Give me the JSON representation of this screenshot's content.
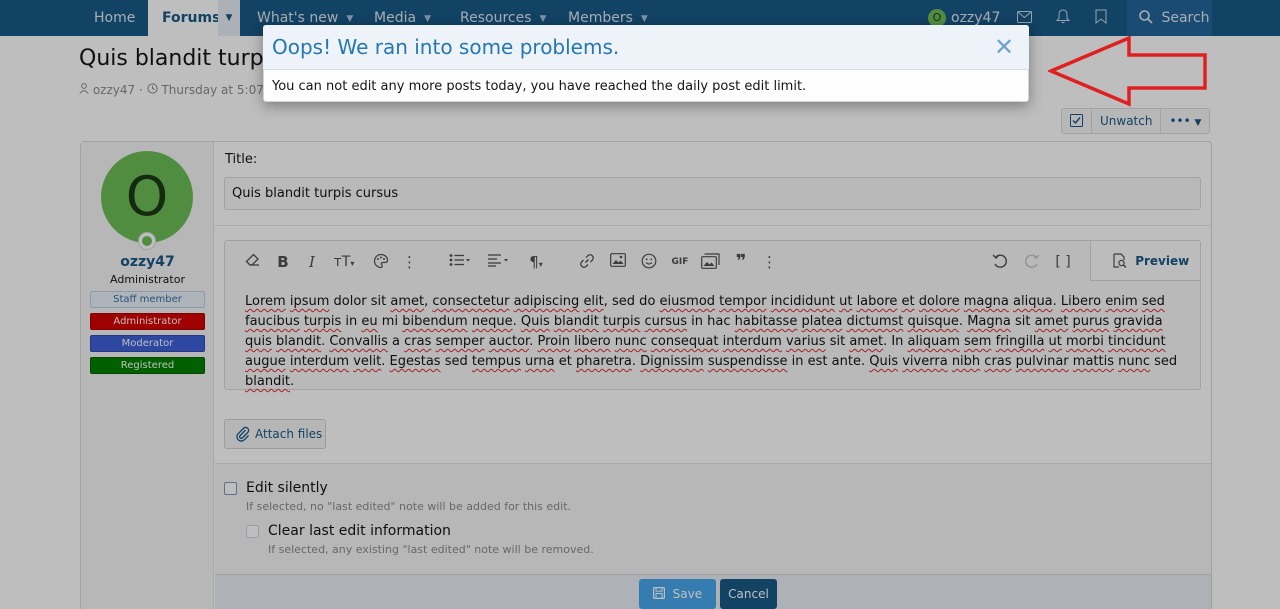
{
  "nav": {
    "tabs": [
      {
        "label": "Home"
      },
      {
        "label": "Forums"
      },
      {
        "label": "What's new"
      },
      {
        "label": "Media"
      },
      {
        "label": "Resources"
      },
      {
        "label": "Members"
      }
    ],
    "user_initial": "O",
    "username": "ozzy47",
    "search_label": "Search"
  },
  "thread": {
    "title": "Quis blandit turpis",
    "author": "ozzy47",
    "date": "Thursday at 5:07 P",
    "watch_label": "Unwatch"
  },
  "user": {
    "initial": "O",
    "name": "ozzy47",
    "title": "Administrator",
    "banners": [
      "Staff member",
      "Administrator",
      "Moderator",
      "Registered"
    ]
  },
  "form": {
    "title_label": "Title:",
    "title_value": "Quis blandit turpis cursus",
    "preview_label": "Preview",
    "attach_label": "Attach files",
    "edit_silently_label": "Edit silently",
    "edit_silently_hint": "If selected, no \"last edited\" note will be added for this edit.",
    "clear_edit_label": "Clear last edit information",
    "clear_edit_hint": "If selected, any existing \"last edited\" note will be removed.",
    "save_label": "Save",
    "cancel_label": "Cancel"
  },
  "editor": {
    "segments": [
      {
        "t": "Lorem",
        "m": true
      },
      {
        "t": " "
      },
      {
        "t": "ipsum",
        "m": true
      },
      {
        "t": " dolor sit "
      },
      {
        "t": "amet",
        "m": true
      },
      {
        "t": ", "
      },
      {
        "t": "consectetur",
        "m": true
      },
      {
        "t": " "
      },
      {
        "t": "adipiscing",
        "m": true
      },
      {
        "t": " "
      },
      {
        "t": "elit",
        "m": true
      },
      {
        "t": ", sed do "
      },
      {
        "t": "eiusmod",
        "m": true
      },
      {
        "t": " "
      },
      {
        "t": "tempor",
        "m": true
      },
      {
        "t": " "
      },
      {
        "t": "incididunt",
        "m": true
      },
      {
        "t": " "
      },
      {
        "t": "ut",
        "m": true
      },
      {
        "t": " "
      },
      {
        "t": "labore",
        "m": true
      },
      {
        "t": " "
      },
      {
        "t": "et",
        "m": true
      },
      {
        "t": " "
      },
      {
        "t": "dolore",
        "m": true
      },
      {
        "t": " "
      },
      {
        "t": "magna",
        "m": true
      },
      {
        "t": " "
      },
      {
        "t": "aliqua",
        "m": true
      },
      {
        "t": ". "
      },
      {
        "t": "Libero",
        "m": true
      },
      {
        "t": " "
      },
      {
        "t": "enim",
        "m": true
      },
      {
        "t": " "
      },
      {
        "t": "sed",
        "m": true
      },
      {
        "t": " "
      },
      {
        "t": "faucibus",
        "m": true
      },
      {
        "t": " "
      },
      {
        "t": "turpis",
        "m": true
      },
      {
        "t": " in "
      },
      {
        "t": "eu",
        "m": true
      },
      {
        "t": " mi "
      },
      {
        "t": "bibendum",
        "m": true
      },
      {
        "t": " "
      },
      {
        "t": "neque",
        "m": true
      },
      {
        "t": ". "
      },
      {
        "t": "Quis",
        "m": true
      },
      {
        "t": " "
      },
      {
        "t": "blandit",
        "m": true
      },
      {
        "t": " "
      },
      {
        "t": "turpis",
        "m": true
      },
      {
        "t": " "
      },
      {
        "t": "cursus",
        "m": true
      },
      {
        "t": " in hac "
      },
      {
        "t": "habitasse",
        "m": true
      },
      {
        "t": " "
      },
      {
        "t": "platea",
        "m": true
      },
      {
        "t": " "
      },
      {
        "t": "dictumst",
        "m": true
      },
      {
        "t": " "
      },
      {
        "t": "quisque",
        "m": true
      },
      {
        "t": ". "
      },
      {
        "t": "Magna",
        "m": true
      },
      {
        "t": " sit "
      },
      {
        "t": "amet",
        "m": true
      },
      {
        "t": " "
      },
      {
        "t": "purus",
        "m": true
      },
      {
        "t": " "
      },
      {
        "t": "gravida",
        "m": true
      },
      {
        "t": " "
      },
      {
        "t": "quis",
        "m": true
      },
      {
        "t": " "
      },
      {
        "t": "blandit",
        "m": true
      },
      {
        "t": ". "
      },
      {
        "t": "Convallis",
        "m": true
      },
      {
        "t": " a "
      },
      {
        "t": "cras",
        "m": true
      },
      {
        "t": " "
      },
      {
        "t": "semper",
        "m": true
      },
      {
        "t": " "
      },
      {
        "t": "auctor",
        "m": true
      },
      {
        "t": ". "
      },
      {
        "t": "Proin",
        "m": true
      },
      {
        "t": " "
      },
      {
        "t": "libero",
        "m": true
      },
      {
        "t": " "
      },
      {
        "t": "nunc",
        "m": true
      },
      {
        "t": " "
      },
      {
        "t": "consequat",
        "m": true
      },
      {
        "t": " "
      },
      {
        "t": "interdum",
        "m": true
      },
      {
        "t": " "
      },
      {
        "t": "varius",
        "m": true
      },
      {
        "t": " sit "
      },
      {
        "t": "amet",
        "m": true
      },
      {
        "t": ". In "
      },
      {
        "t": "aliquam",
        "m": true
      },
      {
        "t": " "
      },
      {
        "t": "sem",
        "m": true
      },
      {
        "t": " "
      },
      {
        "t": "fringilla",
        "m": true
      },
      {
        "t": " "
      },
      {
        "t": "ut",
        "m": true
      },
      {
        "t": " "
      },
      {
        "t": "morbi",
        "m": true
      },
      {
        "t": " "
      },
      {
        "t": "tincidunt",
        "m": true
      },
      {
        "t": " "
      },
      {
        "t": "augue",
        "m": true
      },
      {
        "t": " "
      },
      {
        "t": "interdum",
        "m": true
      },
      {
        "t": " "
      },
      {
        "t": "velit",
        "m": true
      },
      {
        "t": ". "
      },
      {
        "t": "Egestas",
        "m": true
      },
      {
        "t": " sed "
      },
      {
        "t": "tempus",
        "m": true
      },
      {
        "t": " "
      },
      {
        "t": "urna",
        "m": true
      },
      {
        "t": " et "
      },
      {
        "t": "pharetra",
        "m": true
      },
      {
        "t": ". "
      },
      {
        "t": "Dignissim",
        "m": true
      },
      {
        "t": " "
      },
      {
        "t": "suspendisse",
        "m": true
      },
      {
        "t": " in est ante. "
      },
      {
        "t": "Quis",
        "m": true
      },
      {
        "t": " "
      },
      {
        "t": "viverra",
        "m": true
      },
      {
        "t": " "
      },
      {
        "t": "nibh",
        "m": true
      },
      {
        "t": " "
      },
      {
        "t": "cras",
        "m": true
      },
      {
        "t": " "
      },
      {
        "t": "pulvinar",
        "m": true
      },
      {
        "t": " "
      },
      {
        "t": "mattis",
        "m": true
      },
      {
        "t": " "
      },
      {
        "t": "nunc",
        "m": true
      },
      {
        "t": " sed "
      },
      {
        "t": "blandit",
        "m": true
      },
      {
        "t": "."
      }
    ]
  },
  "modal": {
    "title": "Oops! We ran into some problems.",
    "message": "You can not edit any more posts today, you have reached the daily post edit limit."
  },
  "colors": {
    "nav_bg": "#185886",
    "accent": "#2577b1",
    "annotation_arrow": "#e02020"
  }
}
